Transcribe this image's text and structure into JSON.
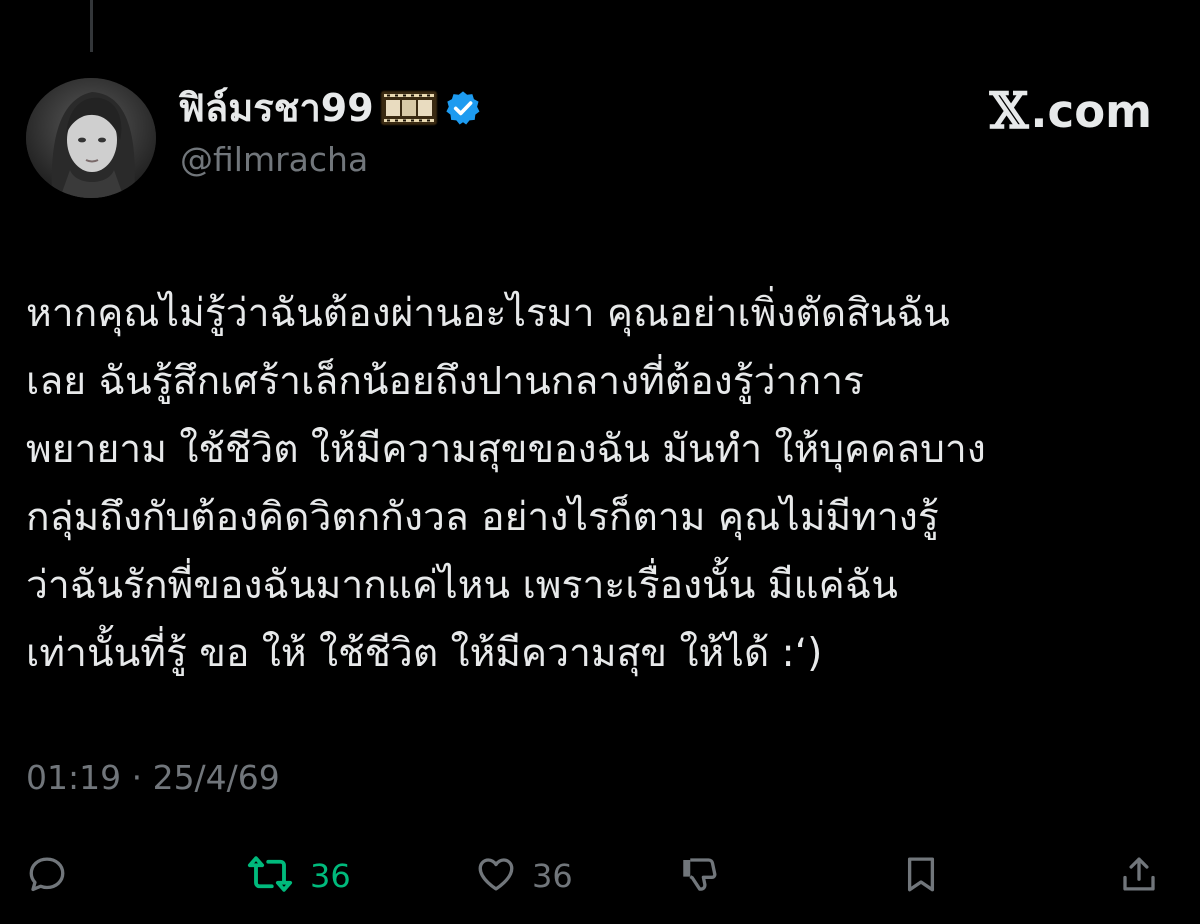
{
  "user": {
    "display_name": "ฟิล์มรชา99",
    "handle": "@filmracha",
    "name_icon": "film-icon",
    "verified": true,
    "verified_color": "#1d9bf0"
  },
  "brand": {
    "x_glyph": "𝕏",
    "domain": ".com"
  },
  "tweet": {
    "lines": [
      "หากคุณไม่รู้ว่าฉันต้องผ่านอะไรมา คุณอย่าเพิ่งตัดสินฉัน",
      "เลย  ฉันรู้สึกเศร้าเล็กน้อยถึงปานกลางที่ต้องรู้ว่าการ",
      "พยายาม ใช้ชีวิต ให้มีความสุขของฉัน มันทำ ให้บุคคลบาง",
      "กลุ่มถึงกับต้องคิดวิตกกังวล อย่างไรก็ตาม คุณไม่มีทางรู้",
      "ว่าฉันรักพี่ของฉันมากแค่ไหน เพราะเรื่องนั้น มีแค่ฉัน",
      "เท่านั้นที่รู้ ขอ ให้ ใช้ชีวิต ให้มีความสุข  ให้ได้ :‘)"
    ],
    "timestamp": "01:19 · 25/4/69"
  },
  "actions": {
    "reply": {
      "icon": "reply-icon"
    },
    "repost": {
      "icon": "repost-icon",
      "count": "36",
      "color": "#00ba7c",
      "active": true
    },
    "like": {
      "icon": "heart-icon",
      "count": "36"
    },
    "dislike": {
      "icon": "thumbs-down-icon"
    },
    "bookmark": {
      "icon": "bookmark-icon"
    },
    "share": {
      "icon": "share-icon"
    }
  },
  "colors": {
    "background": "#000000",
    "text_primary": "#e7e9ea",
    "text_secondary": "#71767b"
  }
}
